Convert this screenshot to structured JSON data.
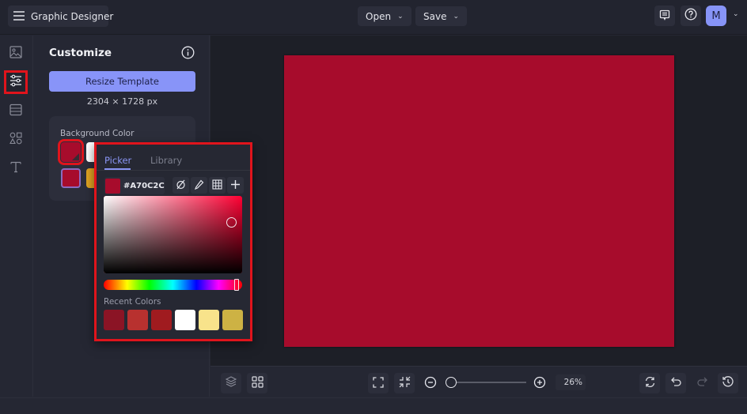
{
  "header": {
    "app_title": "Graphic Designer",
    "menus": [
      {
        "label": "Open",
        "chevron": "chevron-down-icon"
      },
      {
        "label": "Save",
        "chevron": "chevron-down-icon"
      }
    ],
    "right_icons": [
      "feedback-icon",
      "help-icon"
    ],
    "avatar_initial": "M",
    "avatar_color": "#8794f7"
  },
  "rail": {
    "items": [
      {
        "icon": "image-icon",
        "active": false
      },
      {
        "icon": "sliders-icon",
        "active": true
      },
      {
        "icon": "layout-icon",
        "active": false
      },
      {
        "icon": "shapes-icon",
        "active": false
      },
      {
        "icon": "text-icon",
        "active": false
      }
    ]
  },
  "panel": {
    "title": "Customize",
    "resize_button": "Resize Template",
    "dimensions": "2304 × 1728 px",
    "background_color": {
      "label": "Background Color",
      "swatches": [
        "#a70c2c",
        "#ffffff",
        "#a70c2c",
        "#e0a322"
      ]
    }
  },
  "picker": {
    "tabs": [
      {
        "label": "Picker",
        "active": true
      },
      {
        "label": "Library",
        "active": false
      }
    ],
    "hex": "#A70C2C",
    "current_color": "#a70c2c",
    "hue_color": "#ff0033",
    "tools": [
      "no-color-icon",
      "eyedropper-icon",
      "grid-icon",
      "plus-icon"
    ],
    "recent_label": "Recent Colors",
    "recent_colors": [
      "#8b1425",
      "#b8312f",
      "#a01b1f",
      "#ffffff",
      "#f8e38b",
      "#cdb244"
    ]
  },
  "canvas": {
    "background": "#a70c2c"
  },
  "bottombar": {
    "zoom_percent": "26%",
    "zoom_value": 0.26
  },
  "colors": {
    "highlight": "#e0141c",
    "accent": "#8894f8"
  }
}
